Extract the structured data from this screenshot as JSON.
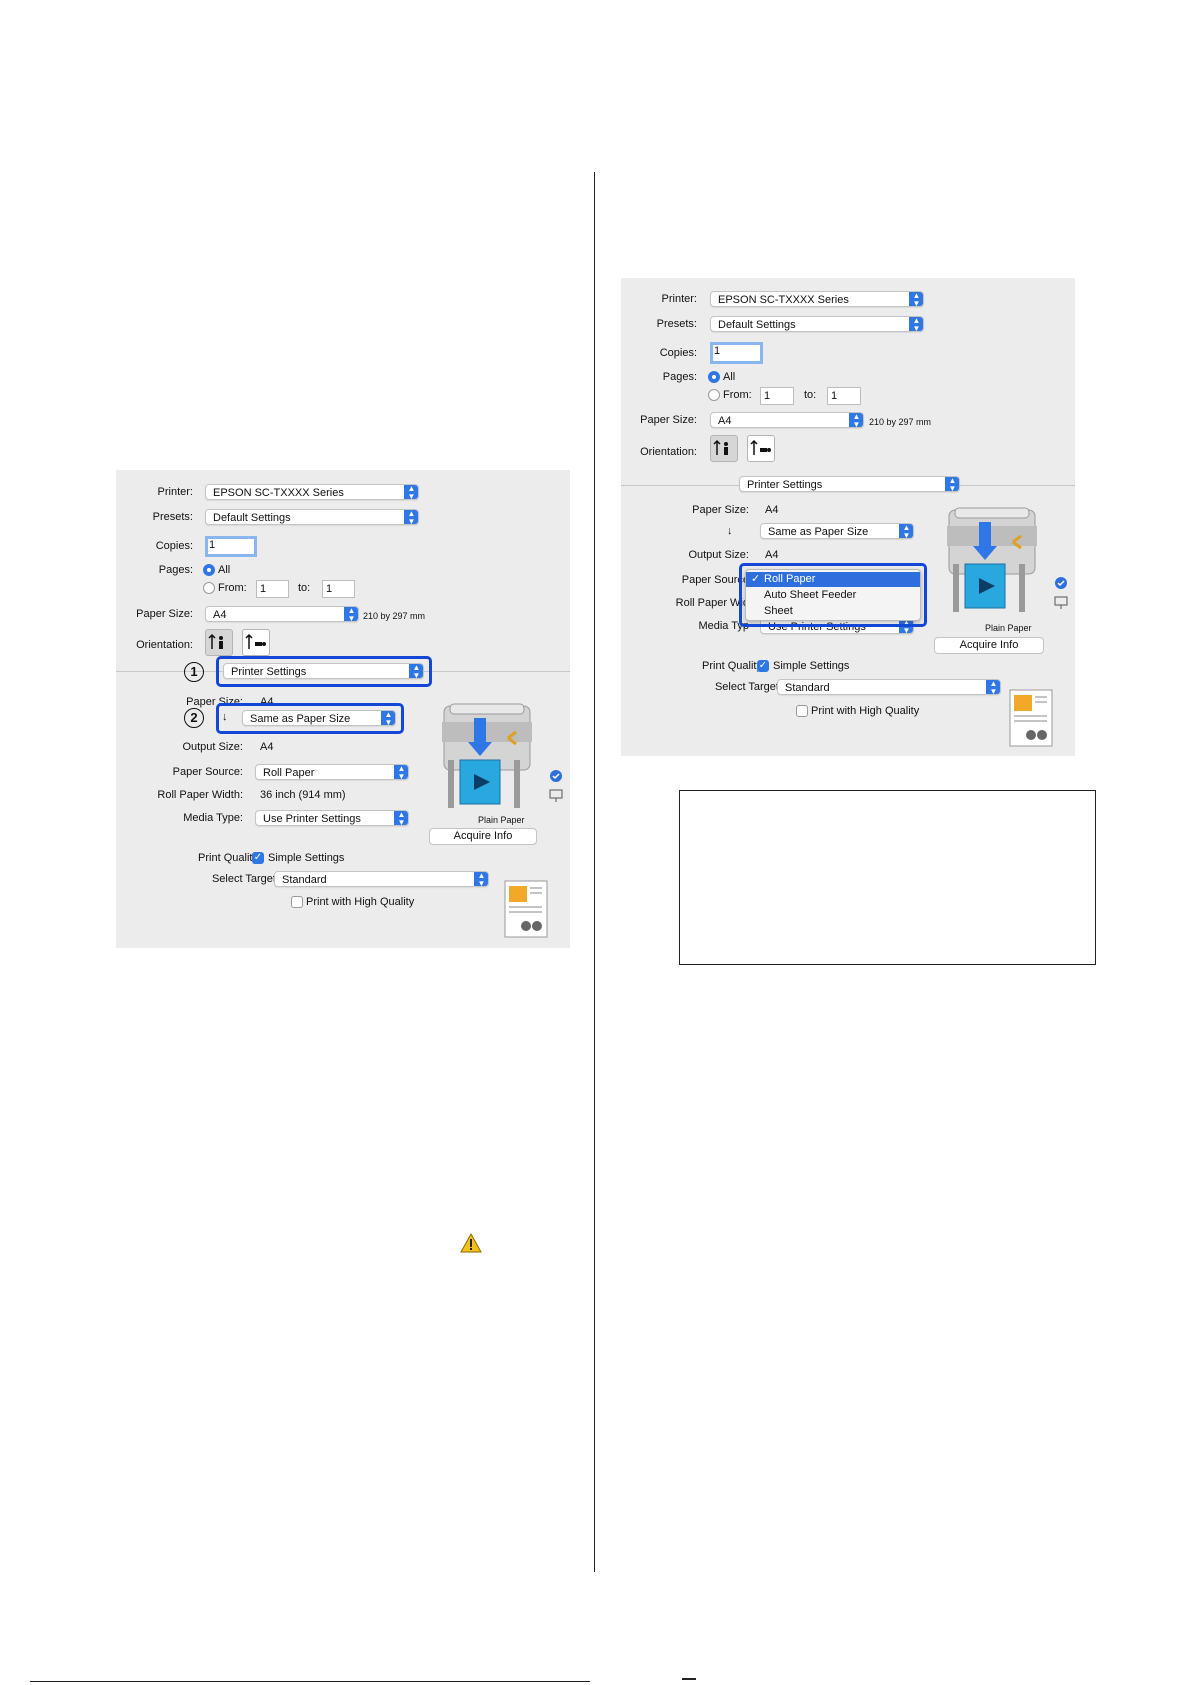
{
  "left_dialog": {
    "printer_label": "Printer:",
    "printer_value": "EPSON SC-TXXXX Series",
    "presets_label": "Presets:",
    "presets_value": "Default Settings",
    "copies_label": "Copies:",
    "copies_value": "1",
    "pages_label": "Pages:",
    "pages_all": "All",
    "pages_from": "From:",
    "from_value": "1",
    "to_label": "to:",
    "to_value": "1",
    "paper_size_label": "Paper Size:",
    "paper_size_value": "A4",
    "paper_size_dims": "210 by 297 mm",
    "orientation_label": "Orientation:",
    "section_value": "Printer Settings",
    "ps_paper_size_label": "Paper Size:",
    "ps_paper_size_value": "A4",
    "scale_value": "Same as Paper Size",
    "output_size_label": "Output Size:",
    "output_size_value": "A4",
    "paper_source_label": "Paper Source:",
    "paper_source_value": "Roll Paper",
    "roll_width_label": "Roll Paper Width:",
    "roll_width_value": "36 inch (914 mm)",
    "media_type_label": "Media Type:",
    "media_type_value": "Use Printer Settings",
    "plain_paper_caption": "Plain Paper",
    "acquire_info": "Acquire Info",
    "print_quality_label": "Print Quality:",
    "simple_settings": "Simple Settings",
    "select_target_label": "Select Target:",
    "select_target_value": "Standard",
    "high_quality": "Print with High Quality",
    "callout_1": "1",
    "callout_2": "2"
  },
  "right_dialog": {
    "printer_label": "Printer:",
    "printer_value": "EPSON SC-TXXXX Series",
    "presets_label": "Presets:",
    "presets_value": "Default Settings",
    "copies_label": "Copies:",
    "copies_value": "1",
    "pages_label": "Pages:",
    "pages_all": "All",
    "pages_from": "From:",
    "from_value": "1",
    "to_label": "to:",
    "to_value": "1",
    "paper_size_label": "Paper Size:",
    "paper_size_value": "A4",
    "paper_size_dims": "210 by 297 mm",
    "orientation_label": "Orientation:",
    "section_value": "Printer Settings",
    "ps_paper_size_label": "Paper Size:",
    "ps_paper_size_value": "A4",
    "scale_value": "Same as Paper Size",
    "output_size_label": "Output Size:",
    "output_size_value": "A4",
    "paper_source_label": "Paper Source",
    "roll_width_label": "Roll Paper Wid",
    "media_type_label": "Media Typ",
    "media_type_value": "Use Printer Settings",
    "menu_items": [
      "Roll Paper",
      "Auto Sheet Feeder",
      "Sheet"
    ],
    "plain_paper_caption": "Plain Paper",
    "acquire_info": "Acquire Info",
    "print_quality_label": "Print Quality:",
    "simple_settings": "Simple Settings",
    "select_target_label": "Select Target:",
    "select_target_value": "Standard",
    "high_quality": "Print with High Quality"
  },
  "colors": {
    "highlight": "#1347d6",
    "accent": "#2f77e6",
    "dialog_bg": "#ececec"
  }
}
